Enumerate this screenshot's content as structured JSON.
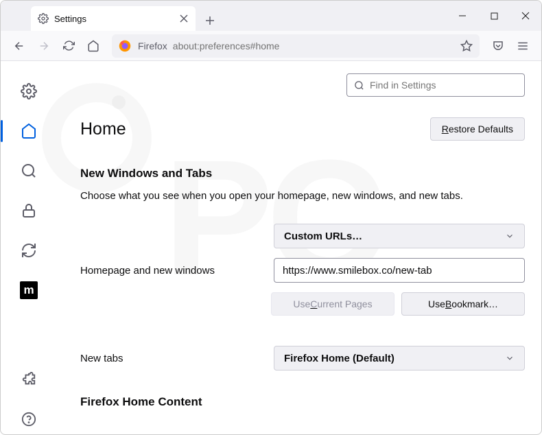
{
  "tab": {
    "title": "Settings"
  },
  "urlbar": {
    "prefix": "Firefox",
    "url": "about:preferences#home"
  },
  "search": {
    "placeholder": "Find in Settings"
  },
  "page": {
    "title": "Home",
    "restore_btn": "Restore Defaults",
    "section1_heading": "New Windows and Tabs",
    "section1_desc": "Choose what you see when you open your homepage, new windows, and new tabs.",
    "homepage_label": "Homepage and new windows",
    "homepage_select": "Custom URLs…",
    "homepage_url": "https://www.smilebox.co/new-tab",
    "use_current": "Use Current Pages",
    "use_bookmark": "Use Bookmark…",
    "newtabs_label": "New tabs",
    "newtabs_select": "Firefox Home (Default)",
    "section2_heading": "Firefox Home Content"
  },
  "moz_glyph": "m"
}
